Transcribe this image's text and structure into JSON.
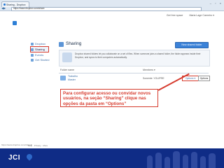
{
  "browser": {
    "tab_title": "Sharing - Dropbox",
    "address": "https://www.dropbox.com/share",
    "window_buttons": "– ▫ ×"
  },
  "header": {
    "user_links": [
      "Get free space",
      "Maria Lage Carneiro ▾"
    ]
  },
  "brand": {
    "logo_text": "Dropbox"
  },
  "sidebar": {
    "items": [
      {
        "label": "Dropbox"
      },
      {
        "label": "Sharing"
      },
      {
        "label": "Events"
      },
      {
        "label": "Get Started"
      }
    ]
  },
  "sharing": {
    "title": "Sharing",
    "new_folder_label": "New shared folder",
    "info_text": "Dropbox shared folders let you collaborate on a set of files. When someone joins a shared folder, the folder appears inside their Dropbox, and syncs to their computers automatically."
  },
  "table": {
    "col_name": "Folder name",
    "col_who": "Members ▾",
    "rows": [
      {
        "name": "Trabalho\nMaster",
        "who": "Somente: YOU/PRE",
        "options": "Options ▾"
      }
    ]
  },
  "menu": {
    "item": "Options"
  },
  "callout": {
    "text": "Para configurar acesso ou convidar novos usuários, na seção “Sharing” clique nas opções da pasta em “Options”"
  },
  "statusbar": {
    "left": "https://www.dropbox.com/share#",
    "right": "Help · Privacy · More"
  },
  "footer": {
    "brand": "JCI"
  },
  "colors": {
    "accent_red": "#d63c2f",
    "footer_blue": "#0f2c86",
    "dropbox_blue": "#2d7fd6"
  }
}
